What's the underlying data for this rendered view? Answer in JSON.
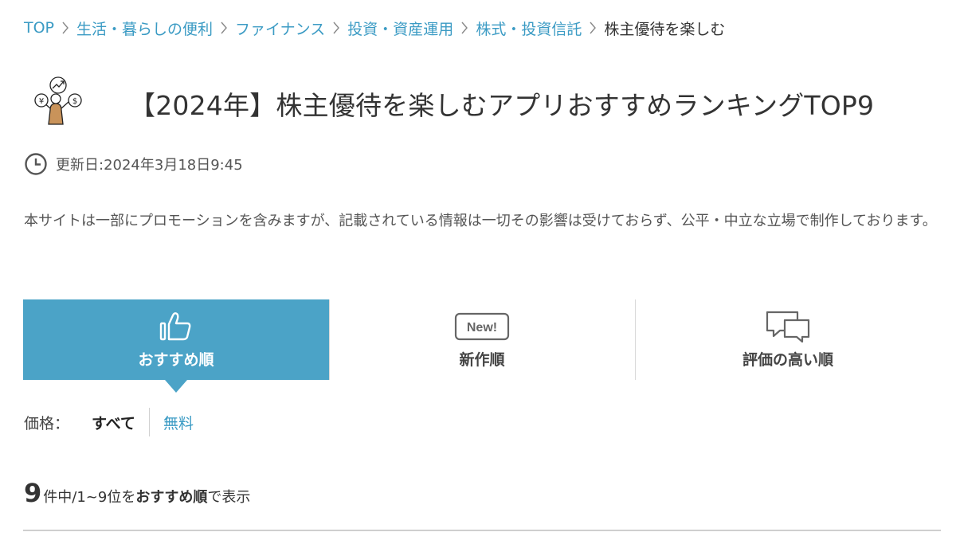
{
  "breadcrumb": {
    "items": [
      {
        "label": "TOP"
      },
      {
        "label": "生活・暮らしの便利"
      },
      {
        "label": "ファイナンス"
      },
      {
        "label": "投資・資産運用"
      },
      {
        "label": "株式・投資信託"
      }
    ],
    "current": "株主優待を楽しむ"
  },
  "title": "【2024年】株主優待を楽しむアプリおすすめランキングTOP9",
  "updated": {
    "icon": "clock-icon",
    "text": "更新日:2024年3月18日9:45"
  },
  "disclaimer": "本サイトは一部にプロモーションを含みますが、記載されている情報は一切その影響は受けておらず、公平・中立な立場で制作しております。",
  "sort_tabs": [
    {
      "label": "おすすめ順",
      "icon": "thumbs-up-icon",
      "active": true
    },
    {
      "label": "新作順",
      "icon": "new-badge-icon",
      "icon_text": "New!",
      "active": false
    },
    {
      "label": "評価の高い順",
      "icon": "chat-bubbles-icon",
      "active": false
    }
  ],
  "price_filter": {
    "label": "価格：",
    "options": [
      "すべて",
      "無料"
    ],
    "selected": "すべて"
  },
  "result": {
    "total": "9",
    "range_text": "件中/1~9位を",
    "sort_name": "おすすめ順",
    "suffix": "で表示"
  },
  "colors": {
    "accent": "#4ba3c7",
    "link": "#3b9bc4",
    "text": "#333333"
  }
}
